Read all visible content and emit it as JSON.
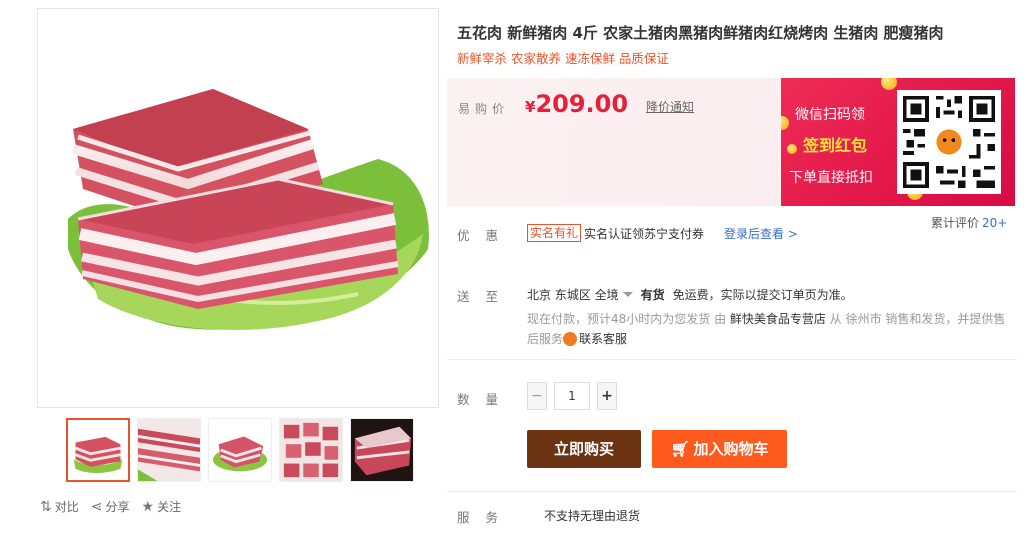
{
  "product": {
    "title": "五花肉 新鲜猪肉 4斤 农家土猪肉黑猪肉鲜猪肉红烧烤肉 生猪肉 肥瘦猪肉",
    "subtitle": "新鲜宰杀 农家散养 速冻保鲜 品质保证"
  },
  "gallery": {
    "thumbnails": [
      "thumb-1",
      "thumb-2",
      "thumb-3",
      "thumb-4",
      "thumb-5"
    ],
    "active_index": 0
  },
  "tools": {
    "compare": "对比",
    "share": "分享",
    "follow": "关注"
  },
  "price": {
    "label": "易购价",
    "currency": "¥",
    "value": "209.00",
    "notify": "降价通知"
  },
  "promo": {
    "line1": "微信扫码领",
    "line2": "签到红包",
    "line3": "下单直接抵扣",
    "arrows": "》》》"
  },
  "review": {
    "label": "累计评价",
    "count": "20+"
  },
  "discount": {
    "label": "优惠",
    "tag": "实名有礼",
    "text": "实名认证领苏宁支付券",
    "link": "登录后查看 >"
  },
  "shipping": {
    "label": "送至",
    "region": "北京 东城区 全境",
    "stock": "有货",
    "fee": "免运费，实际以提交订单页为准。",
    "note_prefix": "现在付款，预计48小时内为您发货   由",
    "store": "鲜快美食品专营店",
    "note_mid": "从 徐州市 销售和发货，并提供售后服务",
    "cs": "联系客服"
  },
  "quantity": {
    "label": "数量",
    "minus": "−",
    "value": "1",
    "plus": "+"
  },
  "actions": {
    "buy": "立即购买",
    "cart": "加入购物车"
  },
  "service": {
    "label": "服务",
    "text": "不支持无理由退货"
  },
  "colors": {
    "accent": "#e8542a",
    "price": "#e4203a",
    "buy_button": "#6b3312",
    "cart_button": "#ff5a1e",
    "link": "#3a6fc4"
  }
}
